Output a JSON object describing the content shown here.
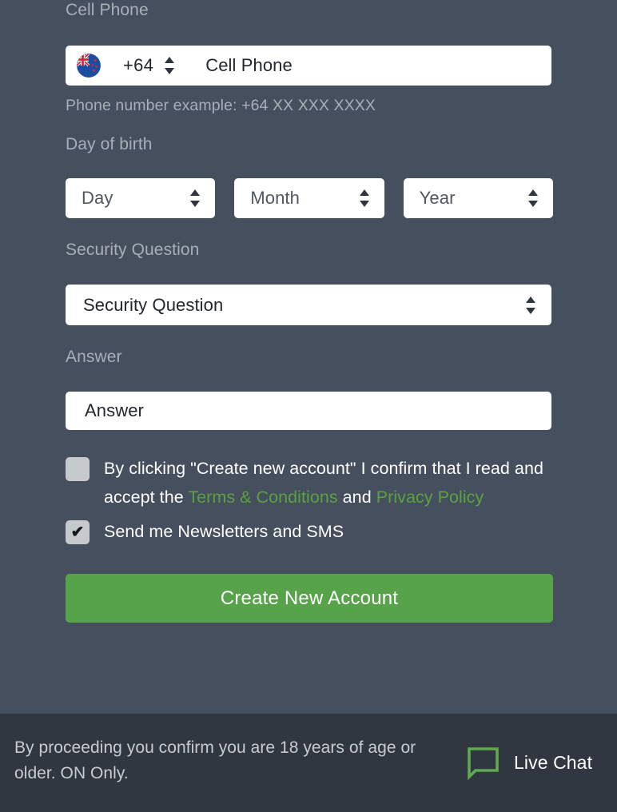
{
  "form": {
    "cell_phone": {
      "label": "Cell Phone",
      "flag_icon": "new-zealand-flag-icon",
      "dial_code": "+64",
      "placeholder": "Cell Phone",
      "value": "",
      "help_text": "Phone number example: +64 XX XXX XXXX"
    },
    "day_of_birth": {
      "label": "Day of birth",
      "selects": [
        {
          "name": "day",
          "value": "Day"
        },
        {
          "name": "month",
          "value": "Month"
        },
        {
          "name": "year",
          "value": "Year"
        }
      ]
    },
    "security_question": {
      "label": "Security Question",
      "value": "Security Question"
    },
    "answer": {
      "label": "Answer",
      "placeholder": "Answer",
      "value": "Answer"
    },
    "terms_checkbox": {
      "checked": false,
      "mark": "",
      "text_before": "By clicking \"Create new account\" I confirm that I read and accept the ",
      "link_terms": "Terms & Conditions",
      "text_between": " and ",
      "link_privacy": "Privacy Policy"
    },
    "newsletter_checkbox": {
      "checked": true,
      "mark": "✔",
      "label": "Send me Newsletters and SMS"
    },
    "submit_button": {
      "label": "Create New Account"
    }
  },
  "footer": {
    "disclaimer": "By proceeding you confirm you are 18 years of age or older. ON Only.",
    "live_chat": {
      "icon": "chat-bubble-icon",
      "label": "Live Chat"
    }
  },
  "colors": {
    "background": "#464f5e",
    "footer_background": "#303740",
    "accent_green": "#56a34a",
    "link_green": "#59a23f",
    "label_grey": "#a9afb6",
    "control_white": "#ffffff",
    "checkbox_grey": "#c6cacd"
  }
}
